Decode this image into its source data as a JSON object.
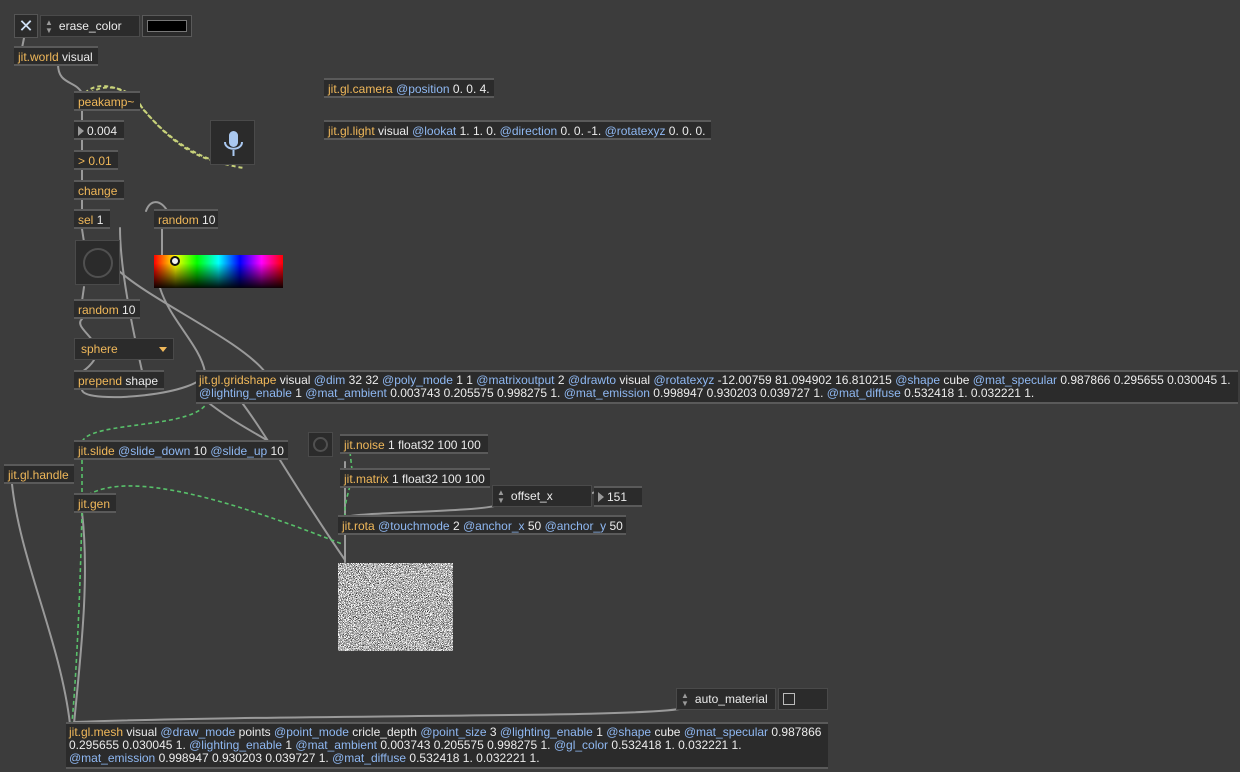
{
  "toolbar": {
    "close_glyph": "✕",
    "erase_color_label": "erase_color",
    "erase_color_swatch": "#000000"
  },
  "objects": {
    "jit_world": {
      "cls": "jit.world",
      "args": "visual"
    },
    "peakamp": {
      "cls": "peakamp~"
    },
    "number_peak": {
      "value": "0.004"
    },
    "gt": {
      "cls": "> 0.01"
    },
    "change": {
      "cls": "change"
    },
    "sel": {
      "cls": "sel",
      "args": "1"
    },
    "random_top": {
      "cls": "random",
      "args": "10"
    },
    "random_mid": {
      "cls": "random",
      "args": "10"
    },
    "shape_menu": {
      "value": "sphere"
    },
    "prepend": {
      "cls": "prepend",
      "args": "shape"
    },
    "camera": {
      "cls": "jit.gl.camera",
      "attr1": "@position",
      "val1": "0. 0. 4."
    },
    "light": {
      "cls": "jit.gl.light",
      "args": "visual",
      "attr1": "@lookat",
      "val1": "1. 1. 0.",
      "attr2": "@direction",
      "val2": "0. 0. -1.",
      "attr3": "@rotatexyz",
      "val3": "0. 0. 0."
    },
    "gridshape": {
      "cls": "jit.gl.gridshape",
      "args": "visual",
      "a1": "@dim",
      "v1": "32 32",
      "a2": "@poly_mode",
      "v2": "1 1",
      "a3": "@matrixoutput",
      "v3": "2",
      "a4": "@drawto",
      "v4": "visual",
      "a5": "@rotatexyz",
      "v5": "-12.00759 81.094902 16.810215",
      "a6": "@shape",
      "v6": "cube",
      "a7": "@mat_specular",
      "v7": "0.987866 0.295655 0.030045 1.",
      "a8": "@lighting_enable",
      "v8": "1",
      "a9": "@mat_ambient",
      "v9": "0.003743 0.205575 0.998275 1.",
      "a10": "@mat_emission",
      "v10": "0.998947 0.930203 0.039727 1.",
      "a11": "@mat_diffuse",
      "v11": "0.532418 1. 0.032221 1."
    },
    "slide": {
      "cls": "jit.slide",
      "a1": "@slide_down",
      "v1": "10",
      "a2": "@slide_up",
      "v2": "10"
    },
    "handle": {
      "cls": "jit.gl.handle"
    },
    "gen": {
      "cls": "jit.gen"
    },
    "noise": {
      "cls": "jit.noise",
      "args": "1 float32 100 100"
    },
    "matrix": {
      "cls": "jit.matrix",
      "args": "1 float32 100 100"
    },
    "offset_menu": {
      "value": "offset_x"
    },
    "offset_number": {
      "value": "151"
    },
    "rota": {
      "cls": "jit.rota",
      "a1": "@touchmode",
      "v1": "2",
      "a2": "@anchor_x",
      "v2": "50",
      "a3": "@anchor_y",
      "v3": "50"
    },
    "auto_material": {
      "value": "auto_material"
    },
    "mesh": {
      "cls": "jit.gl.mesh",
      "args": "visual",
      "a1": "@draw_mode",
      "v1": "points",
      "a2": "@point_mode",
      "v2": "cricle_depth",
      "a3": "@point_size",
      "v3": "3",
      "a4": "@lighting_enable",
      "v4": "1",
      "a5": "@shape",
      "v5": "cube",
      "a6": "@mat_specular",
      "v6": "0.987866 0.295655 0.030045 1.",
      "a7": "@lighting_enable",
      "v7": "1",
      "a8": "@mat_ambient",
      "v8": "0.003743 0.205575 0.998275 1.",
      "a9": "@gl_color",
      "v9": "0.532418 1. 0.032221 1.",
      "a10": "@mat_emission",
      "v10": "0.998947 0.930203 0.039727 1.",
      "a11": "@mat_diffuse",
      "v11": "0.532418 1. 0.032221 1."
    }
  },
  "colors": {
    "background": "#3c3c3c",
    "object_bg": "#2b2b2b",
    "class_text": "#f0b85a",
    "attribute_text": "#8fb8f2",
    "patch_cord": "#9a9a9a",
    "signal_cord": "#c8d27a",
    "matrix_cord": "#58c06a",
    "mic_icon": "#aac8f0"
  },
  "icons": {
    "close": "close-icon",
    "microphone": "microphone-icon",
    "bang": "bang-icon",
    "dropdown": "chevron-down-icon"
  }
}
